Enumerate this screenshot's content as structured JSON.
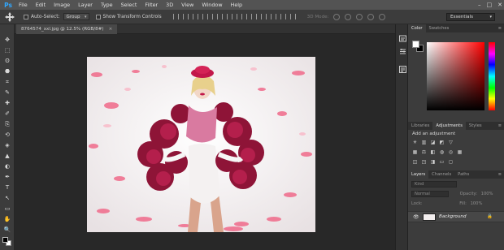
{
  "app": {
    "logo": "Ps"
  },
  "menu": [
    "File",
    "Edit",
    "Image",
    "Layer",
    "Type",
    "Select",
    "Filter",
    "3D",
    "View",
    "Window",
    "Help"
  ],
  "window_controls": [
    "–",
    "□",
    "✕"
  ],
  "options": {
    "auto_select_label": "Auto-Select:",
    "auto_select_target": "Group",
    "show_transform_label": "Show Transform Controls",
    "mode3d_label": "3D Mode:",
    "workspace": "Essentials"
  },
  "tools": [
    "✥",
    "⬚",
    "ʘ",
    "⬣",
    "⌗",
    "✎",
    "✚",
    "✐",
    "⎘",
    "⟲",
    "◈",
    "▲",
    "◐",
    "✒",
    "T",
    "↖",
    "▭",
    "✋",
    "🔍"
  ],
  "document": {
    "tab_title": "8764574_xxl.jpg @ 12.5% (RGB/8#)",
    "close": "×"
  },
  "panels": {
    "color_tabs": [
      "Color",
      "Swatches"
    ],
    "adjust_tabs": [
      "Libraries",
      "Adjustments",
      "Styles"
    ],
    "adjust_title": "Add an adjustment",
    "layers_tabs": [
      "Layers",
      "Channels",
      "Paths"
    ],
    "layers": {
      "kind_placeholder": "Kind",
      "blend_mode": "Normal",
      "opacity_label": "Opacity:",
      "opacity_value": "100%",
      "lock_label": "Lock:",
      "fill_label": "Fill:",
      "fill_value": "100%",
      "layer_name": "Background"
    },
    "menu_icon": "≡"
  },
  "colors": {
    "accent": "#31a8ff",
    "panel": "#3c3c3c",
    "bg": "#282828"
  }
}
